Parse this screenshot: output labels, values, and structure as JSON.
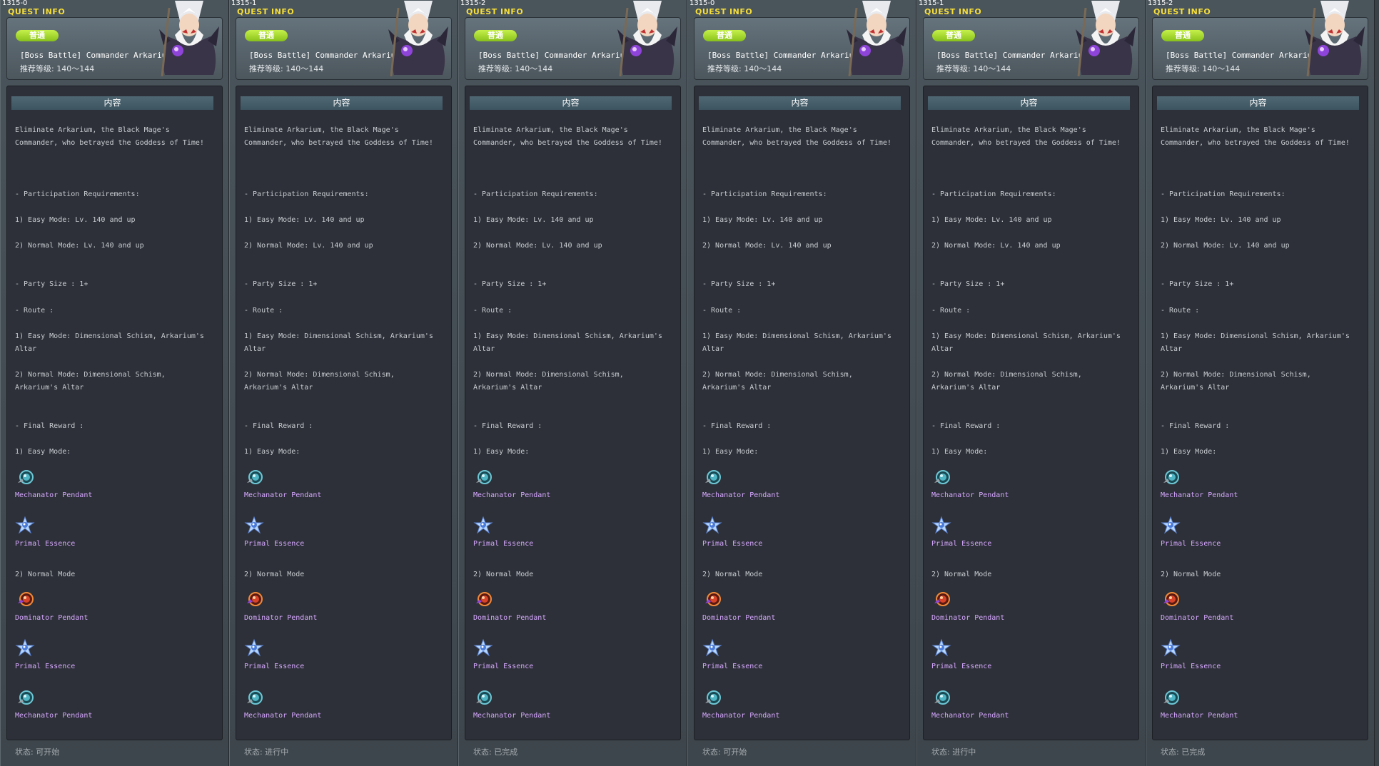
{
  "panels": [
    {
      "id": "1315-0",
      "status": "状态:  可开始"
    },
    {
      "id": "1315-1",
      "status": "状态:  进行中"
    },
    {
      "id": "1315-2",
      "status": "状态:  已完成"
    },
    {
      "id": "1315-0",
      "status": "状态:  可开始"
    },
    {
      "id": "1315-1",
      "status": "状态:  进行中"
    },
    {
      "id": "1315-2",
      "status": "状态:  已完成"
    }
  ],
  "quest": {
    "window_title": "QUEST INFO",
    "badge": "普通",
    "name": "[Boss Battle] Commander Arkarium",
    "level": "推荐等级:  140～144",
    "content_header": "内容",
    "lines": [
      "Eliminate Arkarium, the Black Mage's",
      "Commander, who betrayed the Goddess of Time!",
      "- Participation Requirements:",
      "1) Easy Mode:  Lv. 140 and up",
      "2) Normal Mode: Lv. 140 and up",
      "- Party Size : 1+",
      "- Route :",
      "1) Easy Mode: Dimensional Schism, Arkarium's",
      "Altar",
      "2) Normal Mode: Dimensional Schism,",
      "Arkarium's Altar",
      "- Final Reward :",
      "1) Easy Mode:",
      "2) Normal Mode"
    ],
    "rewards": [
      {
        "name": "Mechanator Pendant",
        "icon": "mechanator-pendant-icon"
      },
      {
        "name": "Primal Essence",
        "icon": "primal-essence-icon"
      },
      {
        "name": "Dominator Pendant",
        "icon": "dominator-pendant-icon"
      },
      {
        "name": "Primal Essence",
        "icon": "primal-essence-icon"
      },
      {
        "name": "Mechanator Pendant",
        "icon": "mechanator-pendant-icon"
      }
    ]
  },
  "colors": {
    "title": "#f6de3a",
    "badge": "#9ad22a",
    "reward_text": "#d6a8ff",
    "body_text": "#c9cdd2",
    "content_bg": "#2d3038"
  }
}
